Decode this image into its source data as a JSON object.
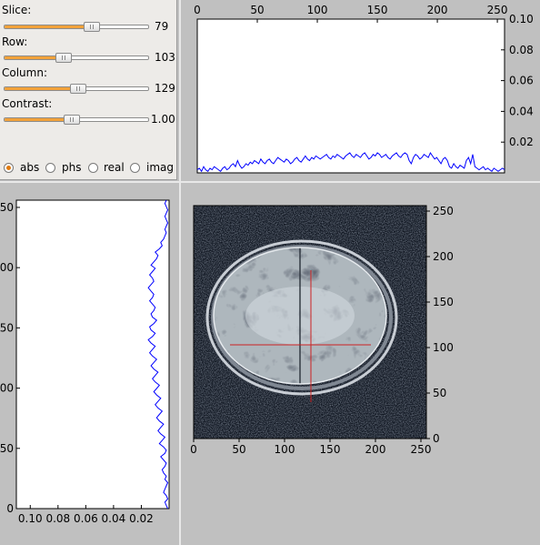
{
  "controls": {
    "sliders": [
      {
        "label": "Slice:",
        "value_text": "79",
        "fraction": 0.61
      },
      {
        "label": "Row:",
        "value_text": "103",
        "fraction": 0.41
      },
      {
        "label": "Column:",
        "value_text": "129",
        "fraction": 0.51
      },
      {
        "label": "Contrast:",
        "value_text": "1.00",
        "fraction": 0.47
      }
    ],
    "modes": [
      {
        "label": "abs",
        "selected": true
      },
      {
        "label": "phs",
        "selected": false
      },
      {
        "label": "real",
        "selected": false
      },
      {
        "label": "imag",
        "selected": false
      }
    ],
    "accent_color": "#f2a23a"
  },
  "chart_data": [
    {
      "type": "line",
      "orientation": "horizontal",
      "xlim": [
        0,
        256
      ],
      "ylim": [
        0,
        0.1
      ],
      "x_ticks": [
        "0",
        "50",
        "100",
        "150",
        "200",
        "250"
      ],
      "y_ticks": [
        "0.02",
        "0.04",
        "0.06",
        "0.08",
        "0.10"
      ],
      "line_color": "#0000ff",
      "series": [
        {
          "values": [
            0.002,
            0.003,
            0.001,
            0.004,
            0.002,
            0.001,
            0.003,
            0.002,
            0.004,
            0.003,
            0.002,
            0.001,
            0.003,
            0.004,
            0.002,
            0.003,
            0.005,
            0.006,
            0.004,
            0.008,
            0.005,
            0.003,
            0.004,
            0.006,
            0.005,
            0.007,
            0.006,
            0.008,
            0.007,
            0.006,
            0.009,
            0.007,
            0.006,
            0.008,
            0.009,
            0.007,
            0.006,
            0.008,
            0.01,
            0.009,
            0.008,
            0.007,
            0.009,
            0.008,
            0.006,
            0.007,
            0.009,
            0.01,
            0.008,
            0.007,
            0.009,
            0.011,
            0.009,
            0.008,
            0.01,
            0.009,
            0.011,
            0.01,
            0.009,
            0.01,
            0.011,
            0.012,
            0.01,
            0.009,
            0.011,
            0.01,
            0.012,
            0.011,
            0.01,
            0.009,
            0.011,
            0.012,
            0.013,
            0.011,
            0.01,
            0.012,
            0.011,
            0.01,
            0.012,
            0.013,
            0.011,
            0.009,
            0.01,
            0.012,
            0.011,
            0.013,
            0.012,
            0.01,
            0.011,
            0.012,
            0.01,
            0.009,
            0.011,
            0.012,
            0.013,
            0.011,
            0.01,
            0.012,
            0.013,
            0.012,
            0.008,
            0.006,
            0.01,
            0.012,
            0.011,
            0.009,
            0.01,
            0.012,
            0.011,
            0.01,
            0.013,
            0.011,
            0.009,
            0.01,
            0.008,
            0.006,
            0.009,
            0.01,
            0.008,
            0.004,
            0.003,
            0.006,
            0.004,
            0.003,
            0.005,
            0.004,
            0.003,
            0.008,
            0.01,
            0.006,
            0.012,
            0.004,
            0.003,
            0.002,
            0.003,
            0.004,
            0.002,
            0.003,
            0.002,
            0.001,
            0.003,
            0.002,
            0.001,
            0.002,
            0.003,
            0.002
          ]
        }
      ]
    },
    {
      "type": "line",
      "orientation": "vertical",
      "xlim": [
        0.11,
        0.0
      ],
      "ylim": [
        0,
        256
      ],
      "x_ticks": [
        "0.10",
        "0.08",
        "0.06",
        "0.04",
        "0.02"
      ],
      "y_ticks": [
        "0",
        "50",
        "100",
        "150",
        "200",
        "250"
      ],
      "line_color": "#0000ff",
      "series": [
        {
          "values": [
            0.001,
            0.002,
            0.003,
            0.001,
            0.002,
            0.004,
            0.003,
            0.002,
            0.001,
            0.003,
            0.002,
            0.004,
            0.005,
            0.003,
            0.002,
            0.004,
            0.006,
            0.003,
            0.002,
            0.004,
            0.007,
            0.005,
            0.003,
            0.006,
            0.008,
            0.006,
            0.004,
            0.007,
            0.009,
            0.007,
            0.005,
            0.008,
            0.01,
            0.008,
            0.006,
            0.009,
            0.011,
            0.009,
            0.007,
            0.01,
            0.012,
            0.01,
            0.008,
            0.011,
            0.013,
            0.011,
            0.009,
            0.012,
            0.014,
            0.012,
            0.01,
            0.013,
            0.015,
            0.012,
            0.01,
            0.013,
            0.014,
            0.011,
            0.009,
            0.012,
            0.013,
            0.011,
            0.01,
            0.012,
            0.014,
            0.012,
            0.011,
            0.013,
            0.015,
            0.013,
            0.011,
            0.012,
            0.014,
            0.012,
            0.01,
            0.013,
            0.011,
            0.009,
            0.008,
            0.01,
            0.007,
            0.005,
            0.006,
            0.004,
            0.003,
            0.002,
            0.003,
            0.002,
            0.001,
            0.002,
            0.003,
            0.002,
            0.001,
            0.002,
            0.003,
            0.002
          ]
        }
      ]
    },
    {
      "type": "heatmap",
      "xlim": [
        0,
        256
      ],
      "ylim": [
        0,
        256
      ],
      "x_ticks": [
        "0",
        "50",
        "100",
        "150",
        "200",
        "250"
      ],
      "y_ticks": [
        "0",
        "50",
        "100",
        "150",
        "200",
        "250"
      ],
      "crosshair": {
        "column": 129,
        "row": 103,
        "color": "#cc2222"
      }
    }
  ]
}
